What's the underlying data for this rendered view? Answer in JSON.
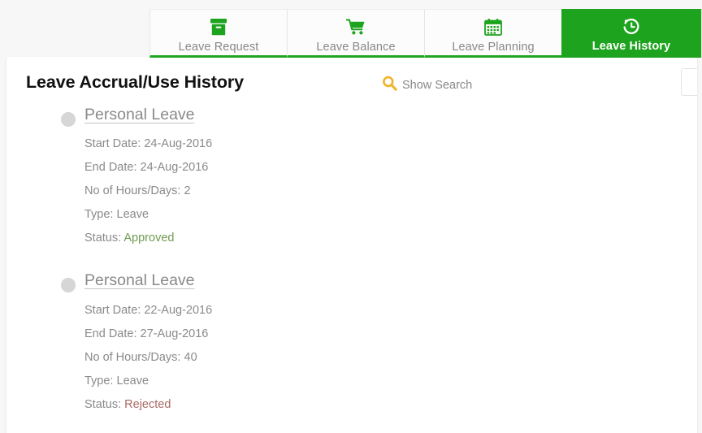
{
  "tabs": [
    {
      "label": "Leave Request",
      "icon": "archive-box-icon",
      "active": false
    },
    {
      "label": "Leave Balance",
      "icon": "shopping-cart-icon",
      "active": false
    },
    {
      "label": "Leave Planning",
      "icon": "calendar-icon",
      "active": false
    },
    {
      "label": "Leave History",
      "icon": "history-clock-icon",
      "active": true
    }
  ],
  "page": {
    "title": "Leave Accrual/Use History",
    "search_toggle_label": "Show Search",
    "search_icon": "magnifier-icon"
  },
  "field_labels": {
    "start_date": "Start Date:",
    "end_date": "End Date:",
    "hours_days": "No of Hours/Days:",
    "type": "Type:",
    "status": "Status:"
  },
  "records": [
    {
      "title": "Personal Leave",
      "start_date": "24-Aug-2016",
      "end_date": "24-Aug-2016",
      "hours_days": "2",
      "type": "Leave",
      "status": "Approved",
      "status_state": "approved"
    },
    {
      "title": "Personal Leave",
      "start_date": "22-Aug-2016",
      "end_date": "27-Aug-2016",
      "hours_days": "40",
      "type": "Leave",
      "status": "Rejected",
      "status_state": "rejected"
    }
  ],
  "colors": {
    "brand_green": "#1ea31e",
    "tab_underline": "#21a521",
    "search_amber": "#f0b429",
    "approved": "#6f9a52",
    "rejected": "#a86a64",
    "muted_text": "#8a8a8a",
    "page_background": "#f7f7f7"
  }
}
